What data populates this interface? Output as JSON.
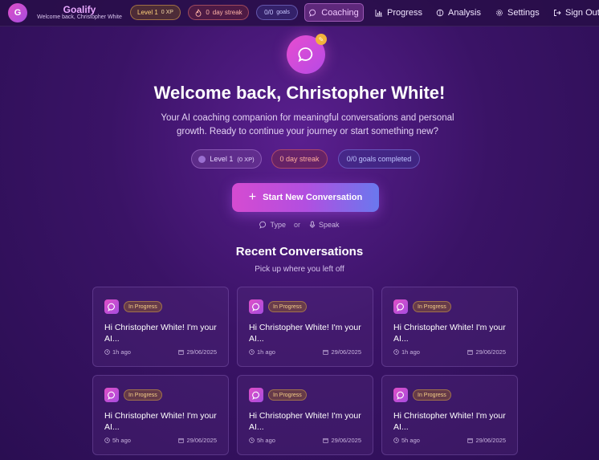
{
  "app": {
    "brand_initial": "G",
    "brand_name": "Goalify",
    "brand_subtitle": "Welcome back, Christopher White"
  },
  "topbar": {
    "level_label": "Level 1",
    "level_xp": "0 XP",
    "streak_value": "0",
    "streak_label": "day streak",
    "goals_value": "0/0",
    "goals_label": "goals",
    "nav": [
      {
        "label": "Coaching",
        "icon": "chat-bubble-icon",
        "active": true
      },
      {
        "label": "Progress",
        "icon": "bar-chart-icon",
        "active": false
      },
      {
        "label": "Analysis",
        "icon": "brain-icon",
        "active": false
      },
      {
        "label": "Settings",
        "icon": "gear-icon",
        "active": false
      },
      {
        "label": "Sign Out",
        "icon": "sign-out-icon",
        "active": false
      }
    ]
  },
  "hero": {
    "badge_glyph": "✎",
    "title": "Welcome back, Christopher White!",
    "tagline": "Your AI coaching companion for meaningful conversations and personal growth. Ready to continue your journey or start something new?",
    "stats": {
      "level_label": "Level 1",
      "level_xp": "(0 XP)",
      "streak": "0 day streak",
      "goals": "0/0 goals completed"
    },
    "cta_plus": "+",
    "cta_label": "Start New Conversation",
    "mode_type": "Type",
    "mode_or": "or",
    "mode_speak": "Speak"
  },
  "recent": {
    "title": "Recent Conversations",
    "subtitle": "Pick up where you left off",
    "cards": [
      {
        "status": "In Progress",
        "message": "Hi Christopher White! I'm your AI...",
        "time": "1h ago",
        "date": "29/06/2025"
      },
      {
        "status": "In Progress",
        "message": "Hi Christopher White! I'm your AI...",
        "time": "1h ago",
        "date": "29/06/2025"
      },
      {
        "status": "In Progress",
        "message": "Hi Christopher White! I'm your AI...",
        "time": "1h ago",
        "date": "29/06/2025"
      },
      {
        "status": "In Progress",
        "message": "Hi Christopher White! I'm your AI...",
        "time": "5h ago",
        "date": "29/06/2025"
      },
      {
        "status": "In Progress",
        "message": "Hi Christopher White! I'm your AI...",
        "time": "5h ago",
        "date": "29/06/2025"
      },
      {
        "status": "In Progress",
        "message": "Hi Christopher White! I'm your AI...",
        "time": "5h ago",
        "date": "29/06/2025"
      }
    ]
  },
  "colors": {
    "background": "#3a1366",
    "accent_pink": "#e04ec6",
    "accent_purple": "#a64de0",
    "accent_blue": "#6a78ee",
    "level_gold": "#ffd27a",
    "streak_coral": "#ffb3a6",
    "goals_lavender": "#c8c6ff"
  }
}
